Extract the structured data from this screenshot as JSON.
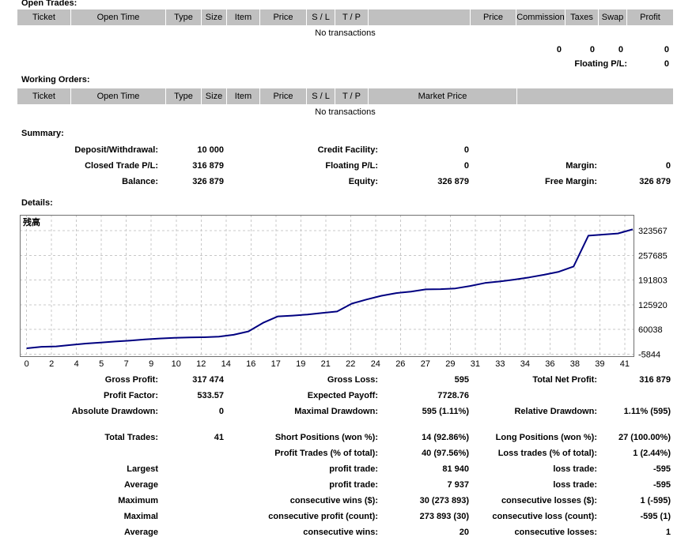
{
  "sections": {
    "open_trades": {
      "heading": "Open Trades:",
      "columns": [
        "Ticket",
        "Open Time",
        "Type",
        "Size",
        "Item",
        "Price",
        "S / L",
        "T / P",
        "",
        "Price",
        "Commission",
        "Taxes",
        "Swap",
        "Profit"
      ],
      "empty_text": "No transactions",
      "totals": [
        "0",
        "0",
        "0",
        "0"
      ],
      "floating_label": "Floating P/L:",
      "floating_value": "0"
    },
    "working_orders": {
      "heading": "Working Orders:",
      "columns": [
        "Ticket",
        "Open Time",
        "Type",
        "Size",
        "Item",
        "Price",
        "S / L",
        "T / P",
        "Market Price",
        ""
      ],
      "empty_text": "No transactions"
    },
    "summary": {
      "heading": "Summary:",
      "rows": [
        [
          "Deposit/Withdrawal:",
          "10 000",
          "Credit Facility:",
          "0",
          "",
          ""
        ],
        [
          "Closed Trade P/L:",
          "316 879",
          "Floating P/L:",
          "0",
          "Margin:",
          "0"
        ],
        [
          "Balance:",
          "326 879",
          "Equity:",
          "326 879",
          "Free Margin:",
          "326 879"
        ]
      ]
    },
    "details": {
      "heading": "Details:",
      "stats_top": [
        [
          "Gross Profit:",
          "317 474",
          "Gross Loss:",
          "595",
          "Total Net Profit:",
          "316 879"
        ],
        [
          "Profit Factor:",
          "533.57",
          "Expected Payoff:",
          "7728.76",
          "",
          ""
        ],
        [
          "Absolute Drawdown:",
          "0",
          "Maximal Drawdown:",
          "595 (1.11%)",
          "Relative Drawdown:",
          "1.11% (595)"
        ]
      ],
      "stats_bottom": [
        [
          "Total Trades:",
          "41",
          "Short Positions (won %):",
          "14 (92.86%)",
          "Long Positions (won %):",
          "27 (100.00%)"
        ],
        [
          "",
          "",
          "Profit Trades (% of total):",
          "40 (97.56%)",
          "Loss trades (% of total):",
          "1 (2.44%)"
        ],
        [
          "Largest",
          "",
          "profit trade:",
          "81 940",
          "loss trade:",
          "-595"
        ],
        [
          "Average",
          "",
          "profit trade:",
          "7 937",
          "loss trade:",
          "-595"
        ],
        [
          "Maximum",
          "",
          "consecutive wins ($):",
          "30 (273 893)",
          "consecutive losses ($):",
          "1 (-595)"
        ],
        [
          "Maximal",
          "",
          "consecutive profit (count):",
          "273 893 (30)",
          "consecutive loss (count):",
          "-595 (1)"
        ],
        [
          "Average",
          "",
          "consecutive wins:",
          "20",
          "consecutive losses:",
          "1"
        ]
      ]
    }
  },
  "chart_data": {
    "type": "line",
    "title": "残高",
    "legend_label": "残高",
    "x": [
      0,
      1,
      2,
      3,
      4,
      5,
      6,
      7,
      8,
      9,
      10,
      11,
      12,
      13,
      14,
      15,
      16,
      17,
      18,
      19,
      20,
      21,
      22,
      23,
      24,
      25,
      26,
      27,
      28,
      29,
      30,
      31,
      32,
      33,
      34,
      35,
      36,
      37,
      38,
      39,
      40,
      41
    ],
    "values": [
      10000,
      14000,
      15000,
      19000,
      22500,
      25000,
      28000,
      30500,
      33500,
      36000,
      38000,
      39000,
      39500,
      41000,
      46000,
      55000,
      78000,
      95000,
      97000,
      100000,
      104000,
      108000,
      129000,
      140000,
      150000,
      157000,
      161000,
      167000,
      167500,
      169500,
      176000,
      184000,
      188000,
      193000,
      199000,
      206000,
      214000,
      228000,
      310000,
      313000,
      316000,
      326879
    ],
    "x_tick_labels": [
      "0",
      "2",
      "4",
      "5",
      "7",
      "9",
      "10",
      "12",
      "14",
      "16",
      "17",
      "19",
      "21",
      "22",
      "24",
      "26",
      "27",
      "29",
      "31",
      "33",
      "34",
      "36",
      "38",
      "39",
      "41"
    ],
    "y_tick_labels": [
      "-5844",
      "60038",
      "125920",
      "191803",
      "257685",
      "323567"
    ],
    "y_tick_values": [
      -5844,
      60038,
      125920,
      191803,
      257685,
      323567
    ],
    "xlim": [
      0,
      41
    ],
    "ylim": [
      -12000,
      335000
    ],
    "grid": "dashed",
    "line_color": "#000080",
    "grid_color": "#c8c8c8",
    "border_color": "#707070"
  }
}
